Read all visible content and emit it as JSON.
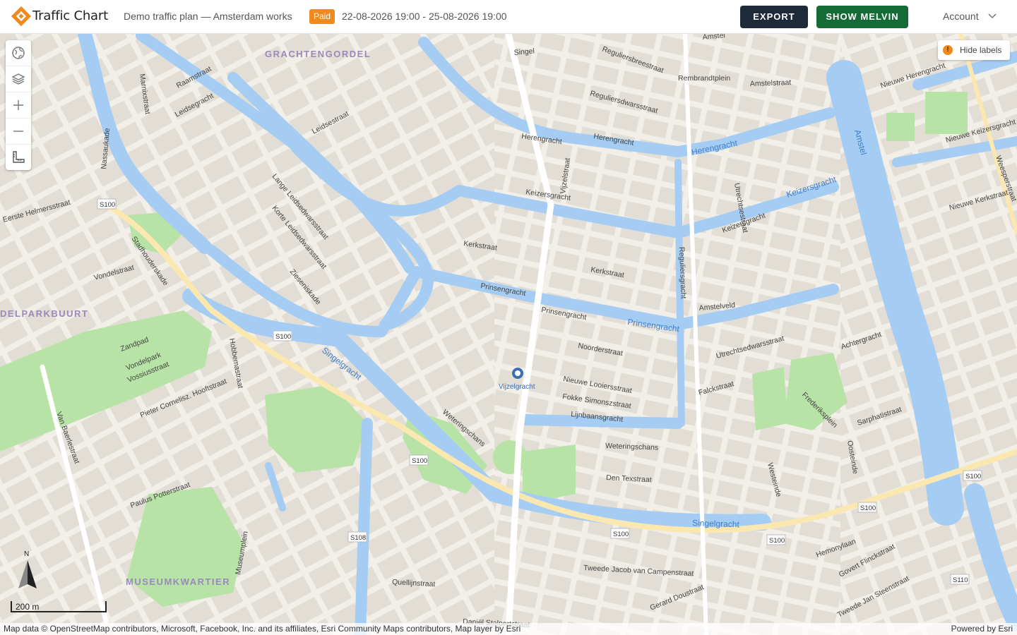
{
  "header": {
    "brand": "Traffic Chart",
    "plan_title": "Demo traffic plan — Amsterdam works",
    "status_badge": "Paid",
    "date_range": "22-08-2026 19:00 - 25-08-2026 19:00",
    "export_label": "EXPORT",
    "melvin_label": "SHOW MELVIN",
    "account_label": "Account",
    "accent": "#f08a1e",
    "export_color": "#1d2a3a",
    "melvin_color": "#156b35"
  },
  "map_tools": [
    "globe-icon",
    "layers-icon",
    "zoom-in-icon",
    "zoom-out-icon",
    "measure-icon"
  ],
  "labels_toggle": {
    "badge": "!",
    "label": "Hide labels"
  },
  "compass": {
    "label": "N"
  },
  "scale_bar": {
    "label": "200 m"
  },
  "attribution": {
    "left": "Map data © OpenStreetMap contributors, Microsoft, Facebook, Inc. and its affiliates, Esri Community Maps contributors, Map layer by Esri",
    "right": "Powered by Esri"
  },
  "map": {
    "districts": [
      "GRACHTENGORDEL",
      "DELPARKBUURT",
      "MUSEUMKWARTIER"
    ],
    "waterways": [
      "Herengracht",
      "Keizersgracht",
      "Prinsengracht",
      "Singelgracht",
      "Singelgracht",
      "Amstel"
    ],
    "streets": [
      "Amstel",
      "Singel",
      "Reguliersbreestraat",
      "Rembrandtplein",
      "Amstelstraat",
      "Nieuwe Herengracht",
      "Reguliersdwarsstraat",
      "Herengracht",
      "Herengracht",
      "Vijzelstraat",
      "Keizersgracht",
      "Keizersgracht",
      "Kerkstraat",
      "Kerkstraat",
      "Prinsengracht",
      "Prinsengracht",
      "Noorderstraat",
      "Nieuwe Looiersstraat",
      "Fokke Simonszstraat",
      "Lijnbaansgracht",
      "Weteringschans",
      "Den Texstraat",
      "Tweede Jacob van Campenstraat",
      "Quellijnstraat",
      "Daniël Stalpertstraat",
      "Gerard Doustraat",
      "Stadhouderskade",
      "Vondelstraat",
      "Leidsegracht",
      "Leidsestraat",
      "Lange Leidsedwarsstraat",
      "Korte Leidsedwarsstraat",
      "Zieseniskade",
      "Weteringschans",
      "Nassaukade",
      "Marnixstraat",
      "Raamstraat",
      "Eerste Helmersstraat",
      "Zandpad",
      "Vondelpark",
      "Vossiusstraat",
      "Hobbemastraat",
      "Pieter Cornelisz. Hooftstraat",
      "Paulus Potterstraat",
      "Van Baerlestraat",
      "Museumplein",
      "Utrechtsestraat",
      "Amstelveld",
      "Falckstraat",
      "Achtergracht",
      "Frederiksplein",
      "Sarphatistraat",
      "Oosteinde",
      "Westeinde",
      "Hemonylaan",
      "Govert Flinckstraat",
      "Tweede Jan Steenstraat",
      "Nieuwe Keizersgracht",
      "Weesperstraat",
      "Nieuwe Kerkstraat",
      "Reguliersgracht",
      "Utrechtsedwarsstraat"
    ],
    "route_shields": [
      "S100",
      "S100",
      "S100",
      "S100",
      "S100",
      "S100",
      "S100",
      "S108",
      "S110"
    ],
    "station": "Vijzelgracht",
    "colors": {
      "land": "#f2efe9",
      "block": "#e2ddd5",
      "water": "#a5cdf3",
      "park": "#b8e3a6",
      "road": "#ffffff",
      "main_road": "#fbe8b0"
    }
  }
}
